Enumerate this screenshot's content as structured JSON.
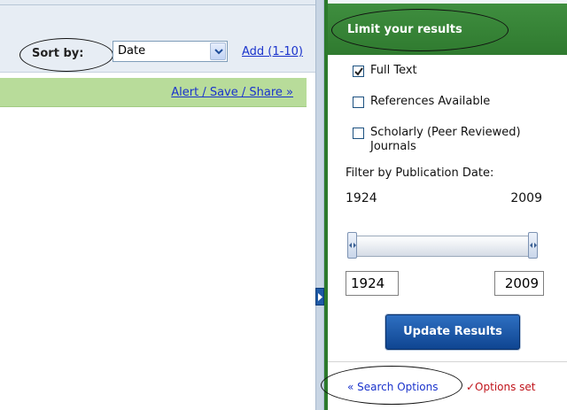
{
  "sort": {
    "label": "Sort by:",
    "selected": "Date",
    "add_link": "Add (1-10)"
  },
  "alert": {
    "link": "Alert / Save / Share »"
  },
  "limit": {
    "title": "Limit your results",
    "options": [
      {
        "label": "Full Text",
        "checked": true
      },
      {
        "label": "References Available",
        "checked": false
      },
      {
        "label": "Scholarly (Peer Reviewed) Journals",
        "checked": false
      }
    ],
    "filter_label": "Filter by Publication Date:",
    "year_min": "1924",
    "year_max": "2009",
    "input_min": "1924",
    "input_max": "2009",
    "update_button": "Update Results",
    "search_options": "« Search Options",
    "options_set": "✓Options set"
  },
  "colors": {
    "panel_green": "#2f7a2f",
    "alert_green": "#b8dc9a",
    "link_blue": "#1a33cc",
    "button_blue": "#0f4591",
    "options_set_red": "#c0141b"
  },
  "icons": [
    "chevron-down-icon",
    "check-icon",
    "expand-arrow-icon",
    "slider-grip-icon"
  ]
}
